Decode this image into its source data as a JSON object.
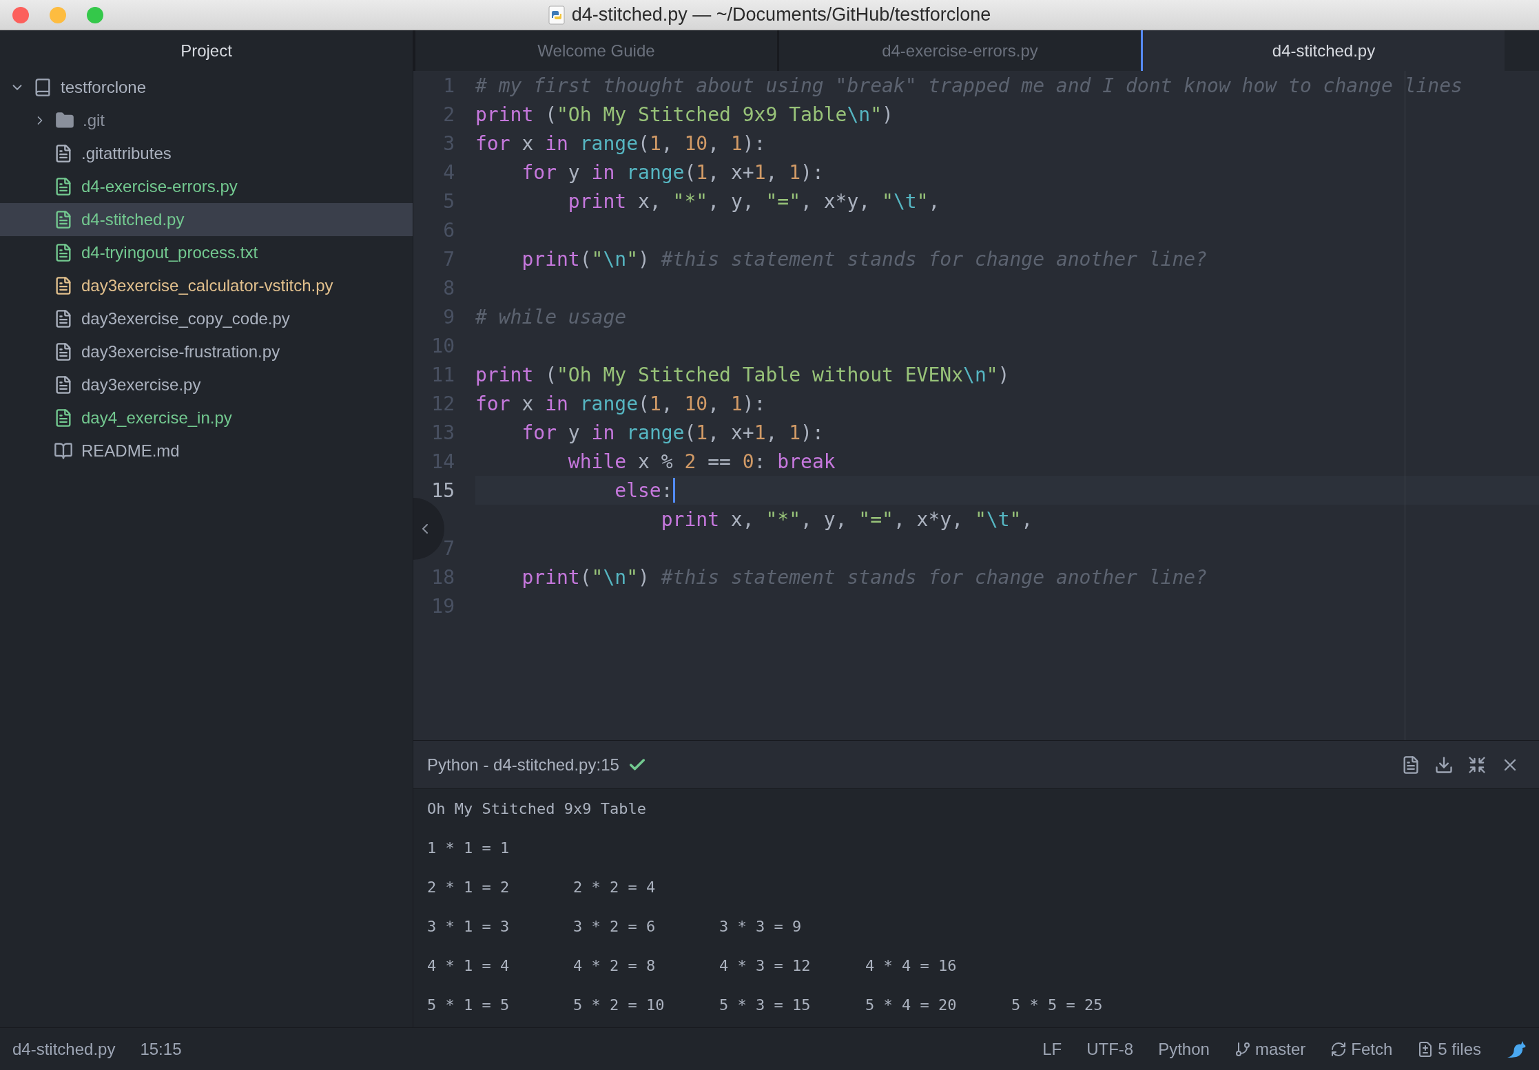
{
  "window": {
    "title": "d4-stitched.py — ~/Documents/GitHub/testforclone"
  },
  "sidebar": {
    "title": "Project",
    "root": {
      "label": "testforclone",
      "expanded": true,
      "children": [
        {
          "label": ".git",
          "kind": "folder",
          "expanded": false,
          "color": "#8a909c",
          "selected": false
        },
        {
          "label": ".gitattributes",
          "kind": "file",
          "color": "#abb2bf",
          "selected": false
        },
        {
          "label": "d4-exercise-errors.py",
          "kind": "file",
          "color": "#73c990",
          "selected": false
        },
        {
          "label": "d4-stitched.py",
          "kind": "file",
          "color": "#73c990",
          "selected": true
        },
        {
          "label": "d4-tryingout_process.txt",
          "kind": "file",
          "color": "#73c990",
          "selected": false
        },
        {
          "label": "day3exercise_calculator-vstitch.py",
          "kind": "file",
          "color": "#e2c08d",
          "selected": false
        },
        {
          "label": "day3exercise_copy_code.py",
          "kind": "file",
          "color": "#abb2bf",
          "selected": false
        },
        {
          "label": "day3exercise-frustration.py",
          "kind": "file",
          "color": "#abb2bf",
          "selected": false
        },
        {
          "label": "day3exercise.py",
          "kind": "file",
          "color": "#abb2bf",
          "selected": false
        },
        {
          "label": "day4_exercise_in.py",
          "kind": "file",
          "color": "#73c990",
          "selected": false
        },
        {
          "label": "README.md",
          "kind": "readme",
          "color": "#abb2bf",
          "selected": false
        }
      ]
    }
  },
  "tabs": [
    {
      "label": "Welcome Guide",
      "selected": false
    },
    {
      "label": "d4-exercise-errors.py",
      "selected": false
    },
    {
      "label": "d4-stitched.py",
      "selected": true
    }
  ],
  "editor": {
    "lines": [
      {
        "number": "1",
        "current": false,
        "tokens": [
          {
            "kind": "comment",
            "text": "# my first thought about using \"break\" trapped me and I dont know how to change lines"
          }
        ]
      },
      {
        "number": "2",
        "current": false,
        "tokens": [
          {
            "kind": "keyword",
            "text": "print"
          },
          {
            "kind": "plain",
            "text": " ("
          },
          {
            "kind": "string",
            "text": "\"Oh My Stitched 9x9 Table"
          },
          {
            "kind": "escape",
            "text": "\\n"
          },
          {
            "kind": "string",
            "text": "\""
          },
          {
            "kind": "plain",
            "text": ")"
          }
        ]
      },
      {
        "number": "3",
        "current": false,
        "tokens": [
          {
            "kind": "keyword",
            "text": "for"
          },
          {
            "kind": "plain",
            "text": " x "
          },
          {
            "kind": "keyword",
            "text": "in"
          },
          {
            "kind": "builtin",
            "text": " range"
          },
          {
            "kind": "plain",
            "text": "("
          },
          {
            "kind": "number",
            "text": "1"
          },
          {
            "kind": "plain",
            "text": ", "
          },
          {
            "kind": "number",
            "text": "10"
          },
          {
            "kind": "plain",
            "text": ", "
          },
          {
            "kind": "number",
            "text": "1"
          },
          {
            "kind": "plain",
            "text": "):"
          }
        ]
      },
      {
        "number": "4",
        "current": false,
        "tokens": [
          {
            "kind": "keyword",
            "text": "    for"
          },
          {
            "kind": "plain",
            "text": " y "
          },
          {
            "kind": "keyword",
            "text": "in"
          },
          {
            "kind": "builtin",
            "text": " range"
          },
          {
            "kind": "plain",
            "text": "("
          },
          {
            "kind": "number",
            "text": "1"
          },
          {
            "kind": "plain",
            "text": ", x+"
          },
          {
            "kind": "number",
            "text": "1"
          },
          {
            "kind": "plain",
            "text": ", "
          },
          {
            "kind": "number",
            "text": "1"
          },
          {
            "kind": "plain",
            "text": "):"
          }
        ]
      },
      {
        "number": "5",
        "current": false,
        "tokens": [
          {
            "kind": "keyword",
            "text": "        print"
          },
          {
            "kind": "plain",
            "text": " x, "
          },
          {
            "kind": "string",
            "text": "\"*\""
          },
          {
            "kind": "plain",
            "text": ", y, "
          },
          {
            "kind": "string",
            "text": "\"=\""
          },
          {
            "kind": "plain",
            "text": ", x*y, "
          },
          {
            "kind": "string",
            "text": "\""
          },
          {
            "kind": "escape",
            "text": "\\t"
          },
          {
            "kind": "string",
            "text": "\""
          },
          {
            "kind": "plain",
            "text": ","
          }
        ]
      },
      {
        "number": "6",
        "current": false
      },
      {
        "number": "7",
        "current": false,
        "tokens": [
          {
            "kind": "keyword",
            "text": "    print"
          },
          {
            "kind": "plain",
            "text": "("
          },
          {
            "kind": "string",
            "text": "\""
          },
          {
            "kind": "escape",
            "text": "\\n"
          },
          {
            "kind": "string",
            "text": "\""
          },
          {
            "kind": "plain",
            "text": ")"
          },
          {
            "kind": "comment",
            "text": " #this statement stands for change another line?"
          }
        ]
      },
      {
        "number": "8",
        "current": false
      },
      {
        "number": "9",
        "current": false,
        "tokens": [
          {
            "kind": "comment",
            "text": "# while usage"
          }
        ]
      },
      {
        "number": "10",
        "current": false
      },
      {
        "number": "11",
        "current": false,
        "tokens": [
          {
            "kind": "keyword",
            "text": "print"
          },
          {
            "kind": "plain",
            "text": " ("
          },
          {
            "kind": "string",
            "text": "\"Oh My Stitched Table without EVENx"
          },
          {
            "kind": "escape",
            "text": "\\n"
          },
          {
            "kind": "string",
            "text": "\""
          },
          {
            "kind": "plain",
            "text": ")"
          }
        ]
      },
      {
        "number": "12",
        "current": false,
        "tokens": [
          {
            "kind": "keyword",
            "text": "for"
          },
          {
            "kind": "plain",
            "text": " x "
          },
          {
            "kind": "keyword",
            "text": "in"
          },
          {
            "kind": "builtin",
            "text": " range"
          },
          {
            "kind": "plain",
            "text": "("
          },
          {
            "kind": "number",
            "text": "1"
          },
          {
            "kind": "plain",
            "text": ", "
          },
          {
            "kind": "number",
            "text": "10"
          },
          {
            "kind": "plain",
            "text": ", "
          },
          {
            "kind": "number",
            "text": "1"
          },
          {
            "kind": "plain",
            "text": "):"
          }
        ]
      },
      {
        "number": "13",
        "current": false,
        "tokens": [
          {
            "kind": "keyword",
            "text": "    for"
          },
          {
            "kind": "plain",
            "text": " y "
          },
          {
            "kind": "keyword",
            "text": "in"
          },
          {
            "kind": "builtin",
            "text": " range"
          },
          {
            "kind": "plain",
            "text": "("
          },
          {
            "kind": "number",
            "text": "1"
          },
          {
            "kind": "plain",
            "text": ", x+"
          },
          {
            "kind": "number",
            "text": "1"
          },
          {
            "kind": "plain",
            "text": ", "
          },
          {
            "kind": "number",
            "text": "1"
          },
          {
            "kind": "plain",
            "text": "):"
          }
        ]
      },
      {
        "number": "14",
        "current": false,
        "tokens": [
          {
            "kind": "keyword",
            "text": "        while"
          },
          {
            "kind": "plain",
            "text": " x % "
          },
          {
            "kind": "number",
            "text": "2"
          },
          {
            "kind": "plain",
            "text": " == "
          },
          {
            "kind": "number",
            "text": "0"
          },
          {
            "kind": "plain",
            "text": ":"
          },
          {
            "kind": "keyword",
            "text": " break"
          }
        ]
      },
      {
        "number": "15",
        "current": true,
        "tokens": [
          {
            "kind": "keyword",
            "text": "            else"
          },
          {
            "kind": "plain",
            "text": ":"
          }
        ]
      },
      {
        "current": false,
        "tokens": [
          {
            "kind": "keyword",
            "text": "                print"
          },
          {
            "kind": "plain",
            "text": " x, "
          },
          {
            "kind": "string",
            "text": "\"*\""
          },
          {
            "kind": "plain",
            "text": ", y, "
          },
          {
            "kind": "string",
            "text": "\"=\""
          },
          {
            "kind": "plain",
            "text": ", x*y, "
          },
          {
            "kind": "string",
            "text": "\""
          },
          {
            "kind": "escape",
            "text": "\\t"
          },
          {
            "kind": "string",
            "text": "\""
          },
          {
            "kind": "plain",
            "text": ","
          }
        ]
      },
      {
        "number": "7",
        "current": false
      },
      {
        "number": "18",
        "current": false,
        "tokens": [
          {
            "kind": "keyword",
            "text": "    print"
          },
          {
            "kind": "plain",
            "text": "("
          },
          {
            "kind": "string",
            "text": "\""
          },
          {
            "kind": "escape",
            "text": "\\n"
          },
          {
            "kind": "string",
            "text": "\""
          },
          {
            "kind": "plain",
            "text": ")"
          },
          {
            "kind": "comment",
            "text": " #this statement stands for change another line?"
          }
        ]
      },
      {
        "number": "19",
        "current": false
      }
    ]
  },
  "output_panel": {
    "title": "Python - d4-stitched.py:15",
    "success": true,
    "rows": [
      [
        "Oh My Stitched 9x9 Table"
      ],
      [
        "1 * 1 = 1"
      ],
      [
        "2 * 1 = 2",
        "2 * 2 = 4"
      ],
      [
        "3 * 1 = 3",
        "3 * 2 = 6",
        "3 * 3 = 9"
      ],
      [
        "4 * 1 = 4",
        "4 * 2 = 8",
        "4 * 3 = 12",
        "4 * 4 = 16"
      ],
      [
        "5 * 1 = 5",
        "5 * 2 = 10",
        "5 * 3 = 15",
        "5 * 4 = 20",
        "5 * 5 = 25"
      ]
    ]
  },
  "status_bar": {
    "file": "d4-stitched.py",
    "cursor": "15:15",
    "line_ending": "LF",
    "encoding": "UTF-8",
    "grammar": "Python",
    "branch": "master",
    "fetch": "Fetch",
    "changes": "5 files"
  }
}
